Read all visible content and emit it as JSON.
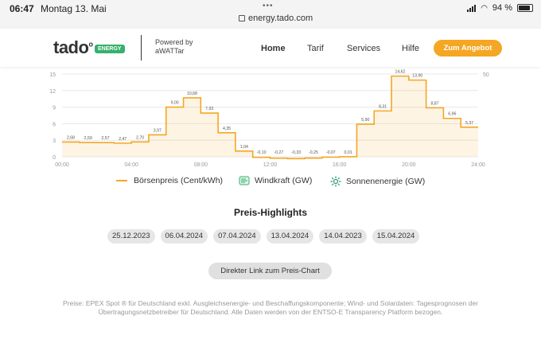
{
  "status_bar": {
    "time": "06:47",
    "date": "Montag 13. Mai",
    "dots": "•••",
    "url": "energy.tado.com",
    "battery": "94 %"
  },
  "header": {
    "logo_text": "tado",
    "logo_badge": "ENERGY",
    "powered_line1": "Powered by",
    "powered_line2": "aWATTar",
    "nav": [
      "Home",
      "Tarif",
      "Services",
      "Hilfe"
    ],
    "cta": "Zum Angebot"
  },
  "chart_data": {
    "type": "line",
    "x_tick_labels": [
      "00:00",
      "04:00",
      "08:00",
      "12:00",
      "16:00",
      "20:00",
      "24:00"
    ],
    "y_left_ticks": [
      "0",
      "3",
      "6",
      "9",
      "12",
      "15"
    ],
    "y_right_ticks": [
      "50"
    ],
    "ylim": [
      0,
      15
    ],
    "xlim": [
      0,
      24
    ],
    "series": [
      {
        "name": "Börsenpreis (Cent/kWh)",
        "color": "#f5a623",
        "values": [
          2.68,
          2.59,
          2.57,
          2.47,
          2.7,
          3.97,
          9.0,
          10.68,
          7.93,
          4.35,
          1.04,
          -0.1,
          -0.27,
          -0.33,
          -0.25,
          -0.07,
          0.01,
          5.9,
          8.31,
          14.62,
          13.9,
          8.87,
          6.96,
          5.37
        ],
        "labels": [
          "2,68",
          "2,59",
          "2,57",
          "2,47",
          "2,70",
          "3,97",
          "9,00",
          "10,68",
          "7,93",
          "4,35",
          "1,04",
          "-0,10",
          "-0,27",
          "-0,33",
          "-0,25",
          "-0,07",
          "0,01",
          "5,90",
          "8,31",
          "14,62",
          "13,90",
          "8,87",
          "6,96",
          "5,37"
        ]
      }
    ],
    "grid": true
  },
  "legend": {
    "price": "Börsenpreis (Cent/kWh)",
    "wind": "Windkraft (GW)",
    "solar": "Sonnenenergie (GW)"
  },
  "highlights": {
    "title": "Preis-Highlights",
    "dates": [
      "25.12.2023",
      "06.04.2024",
      "07.04.2024",
      "13.04.2024",
      "14.04.2023",
      "15.04.2024"
    ]
  },
  "link_button": "Direkter Link zum Preis-Chart",
  "footer": "Preise: EPEX Spot ® für Deutschland exkl. Ausgleichsenergie- und Beschaffungskomponente; Wind- und Solardaten: Tagesprognosen der Übertragungsnetzbetreiber für Deutschland. Alle Daten werden von der ENTSO-E Transparency Platform bezogen."
}
